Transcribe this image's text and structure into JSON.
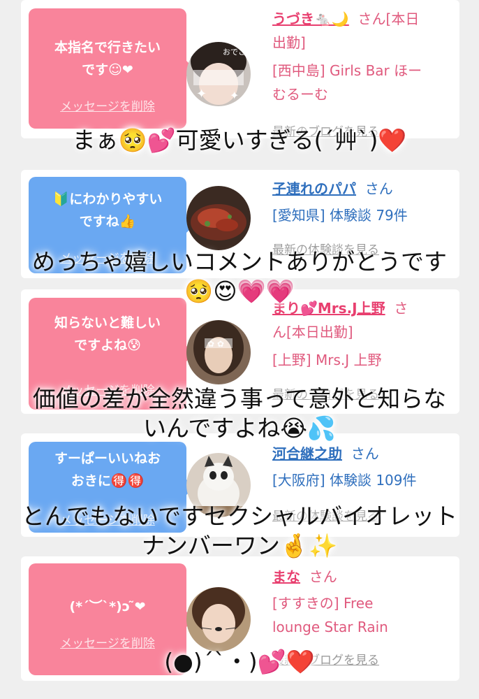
{
  "cards": [
    {
      "bubble_line1": "本指名で行きたい",
      "bubble_line2": "です☺❤",
      "delete_label": "メッセージを削除",
      "name": "うづき🐁🌙",
      "san": "さん[本日",
      "san2": "出勤]",
      "shop_line1": "[西中島] Girls Bar ほー",
      "shop_line2": "むるーむ",
      "link": "最新のブログを見る",
      "avatar_tag": "おでこ"
    },
    {
      "bubble_line1": "🔰にわかりやすい",
      "bubble_line2": "ですね👍",
      "delete_label": "メッセージを削除",
      "name": "子連れのパパ",
      "san": "さん",
      "shop_line1": "[愛知県] 体験談 79件",
      "link": "最新の体験談を見る"
    },
    {
      "bubble_line1": "知らないと難しい",
      "bubble_line2": "ですよね😰",
      "delete_label": "メッセージを削除",
      "name": "まり💕Mrs.J上野",
      "san": "さ",
      "san2": "ん[本日出勤]",
      "shop_line1": "[上野] Mrs.J 上野",
      "link": "最新のブログを見る"
    },
    {
      "bubble_line1": "すーぱーいいねお",
      "bubble_line2": "おきに🉐🉐",
      "delete_label": "メッセージを削除",
      "name": "河合継之助",
      "san": "さん",
      "shop_line1": "[大阪府] 体験談 109件",
      "link": "最新の体験談を見る"
    },
    {
      "bubble_line1": "(*´︶`*)ɔ ̃❤",
      "delete_label": "メッセージを削除",
      "name": "まな",
      "san": "さん",
      "shop_line1": "[すすきの] Free",
      "shop_line2": "lounge Star Rain",
      "link": "最新のブログを見る"
    }
  ],
  "overlays": [
    {
      "line1": "まぁ🥺💕可愛いすぎる(´艸`)❤️"
    },
    {
      "line1": "めっちゃ嬉しいコメントありがとうです",
      "line2": "🥺😍💗💗"
    },
    {
      "line1": "価値の差が全然違う事って意外と知らな",
      "line2": "いんですよね😭💦"
    },
    {
      "line1": "とんでもないですセクシャルバイオレット",
      "line2": "ナンバーワン🤞✨"
    },
    {
      "line1": "(●)´`・)💕❤️"
    }
  ],
  "colors": {
    "pink_bubble": "#f9849b",
    "blue_bubble": "#6aa8f2",
    "name_pink": "#e83f6f",
    "name_blue": "#2f6fbd",
    "background": "#efefef"
  }
}
